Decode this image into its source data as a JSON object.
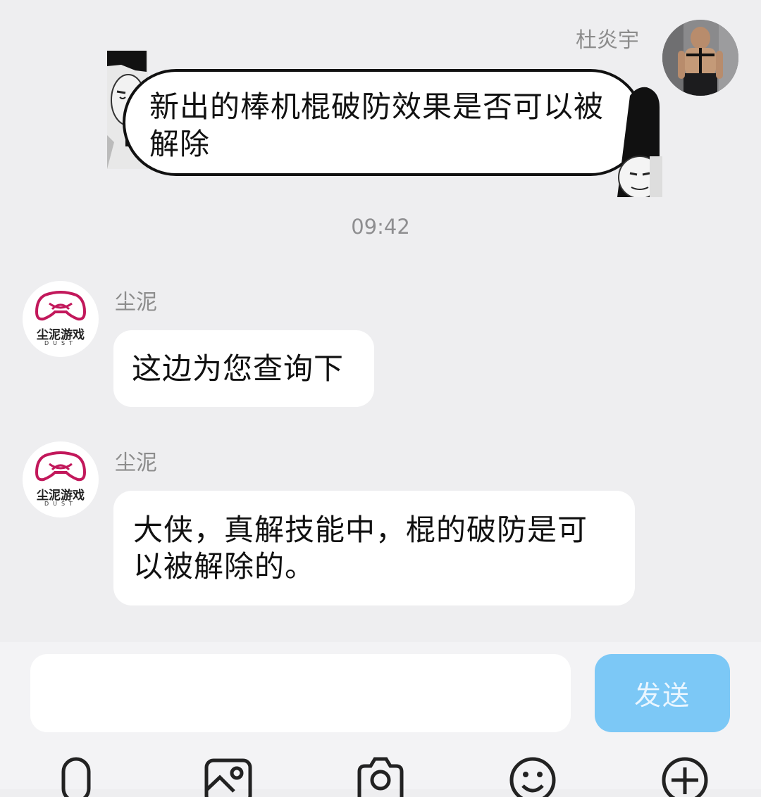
{
  "messages": [
    {
      "sender": "杜炎宇",
      "text": "新出的棒机棍破防效果是否可以被解除"
    },
    {
      "sender": "尘泥",
      "text": "这边为您查询下"
    },
    {
      "sender": "尘泥",
      "text": "大侠，真解技能中，棍的破防是可以被解除的。"
    }
  ],
  "timestamp": "09:42",
  "brand": {
    "name": "尘泥游戏",
    "sub": "DUST",
    "color": "#c2185b"
  },
  "composer": {
    "input_value": "",
    "send_label": "发送",
    "send_color": "#7cc8f6"
  },
  "toolbar": {
    "icons": [
      "microphone-icon",
      "image-icon",
      "camera-icon",
      "emoji-icon",
      "plus-icon"
    ]
  }
}
